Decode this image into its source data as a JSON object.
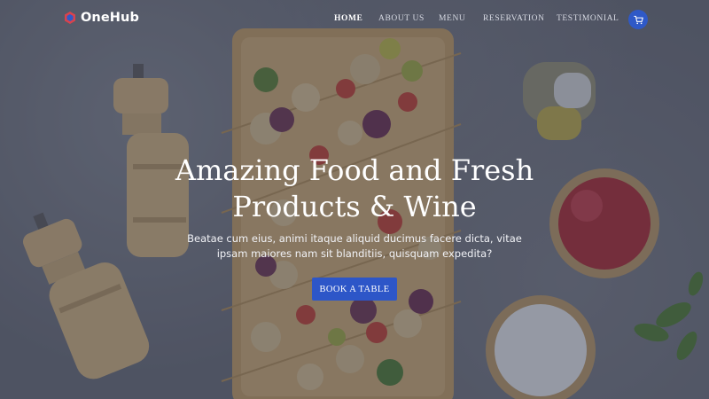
{
  "brand": {
    "name": "OneHub"
  },
  "nav": {
    "items": [
      {
        "label": "HOME",
        "active": true
      },
      {
        "label": "ABOUT US",
        "active": false
      },
      {
        "label": "MENU",
        "active": false
      },
      {
        "label": "RESERVATION",
        "active": false
      },
      {
        "label": "TESTIMONIAL",
        "active": false
      }
    ]
  },
  "cart": {
    "icon": "cart-icon"
  },
  "hero": {
    "title_line1": "Amazing Food and Fresh",
    "title_line2": "Products & Wine",
    "subtitle_line1": "Beatae cum eius, animi itaque aliquid ducimus facere dicta, vitae",
    "subtitle_line2": "ipsam maiores nam sit blanditiis, quisquam expedita?",
    "cta_label": "BOOK A TABLE"
  },
  "colors": {
    "accent": "#2d56c8",
    "logo_red": "#d9434c",
    "logo_blue": "#2f59c7"
  }
}
